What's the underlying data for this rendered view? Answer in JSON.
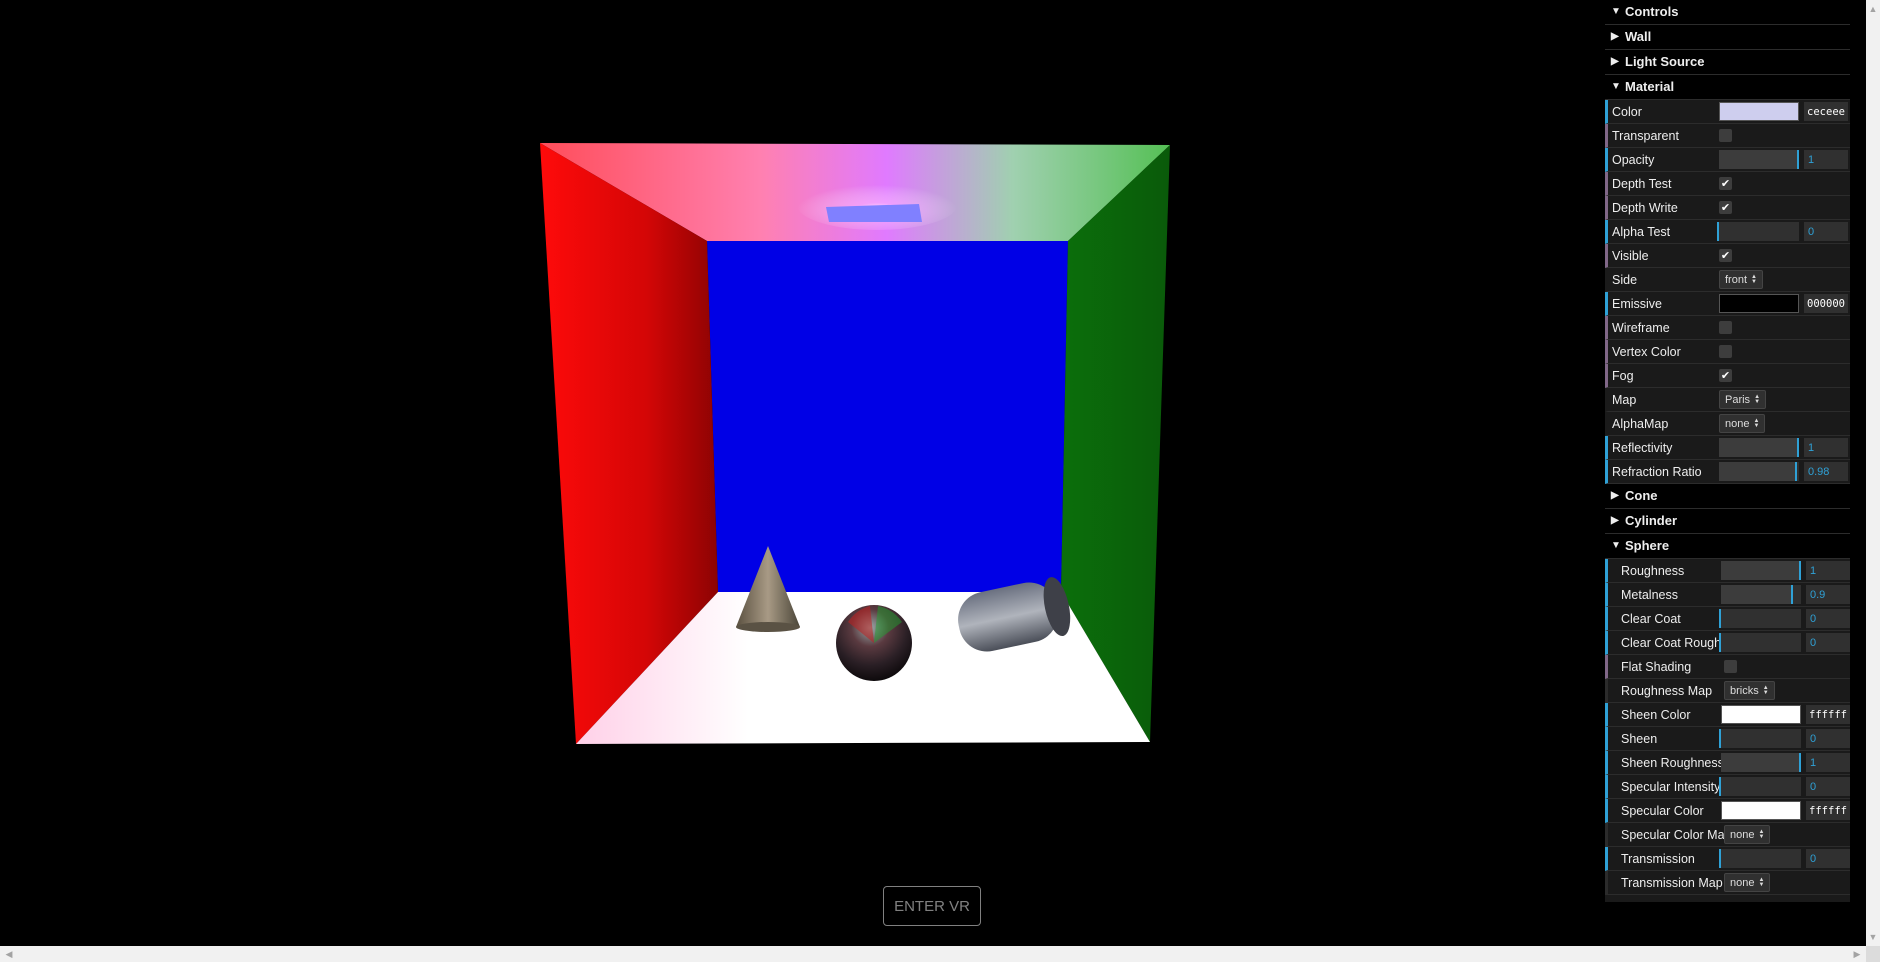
{
  "vr_button": "ENTER VR",
  "gui": {
    "title": "Controls",
    "folders_top": [
      {
        "label": "Wall",
        "open": false
      },
      {
        "label": "Light Source",
        "open": false
      }
    ],
    "material": {
      "label": "Material",
      "rows": [
        {
          "label": "Color",
          "type": "color",
          "color": "#ceceee",
          "hex": "ceceee"
        },
        {
          "label": "Transparent",
          "type": "bool",
          "checked": false
        },
        {
          "label": "Opacity",
          "type": "num",
          "value": "1",
          "fraction": 1
        },
        {
          "label": "Depth Test",
          "type": "bool",
          "checked": true
        },
        {
          "label": "Depth Write",
          "type": "bool",
          "checked": true
        },
        {
          "label": "Alpha Test",
          "type": "num",
          "value": "0",
          "fraction": 0
        },
        {
          "label": "Visible",
          "type": "bool",
          "checked": true
        },
        {
          "label": "Side",
          "type": "select",
          "value": "front"
        },
        {
          "label": "Emissive",
          "type": "color",
          "color": "#000000",
          "hex": "000000"
        },
        {
          "label": "Wireframe",
          "type": "bool",
          "checked": false
        },
        {
          "label": "Vertex Color",
          "type": "bool",
          "checked": false
        },
        {
          "label": "Fog",
          "type": "bool",
          "checked": true
        },
        {
          "label": "Map",
          "type": "select",
          "value": "Paris"
        },
        {
          "label": "AlphaMap",
          "type": "select",
          "value": "none"
        },
        {
          "label": "Reflectivity",
          "type": "num",
          "value": "1",
          "fraction": 1
        },
        {
          "label": "Refraction Ratio",
          "type": "num",
          "value": "0.98",
          "fraction": 0.98
        }
      ]
    },
    "folders_mid": [
      {
        "label": "Cone",
        "open": false
      },
      {
        "label": "Cylinder",
        "open": false
      }
    ],
    "sphere": {
      "label": "Sphere",
      "rows": [
        {
          "label": "Roughness",
          "type": "num",
          "value": "1",
          "fraction": 1
        },
        {
          "label": "Metalness",
          "type": "num",
          "value": "0.9",
          "fraction": 0.9
        },
        {
          "label": "Clear Coat",
          "type": "num",
          "value": "0",
          "fraction": 0
        },
        {
          "label": "Clear Coat Roughness",
          "type": "num",
          "value": "0",
          "fraction": 0
        },
        {
          "label": "Flat Shading",
          "type": "bool",
          "checked": false
        },
        {
          "label": "Roughness Map",
          "type": "select",
          "value": "bricks"
        },
        {
          "label": "Sheen Color",
          "type": "color",
          "color": "#ffffff",
          "hex": "ffffff"
        },
        {
          "label": "Sheen",
          "type": "num",
          "value": "0",
          "fraction": 0
        },
        {
          "label": "Sheen Roughness",
          "type": "num",
          "value": "1",
          "fraction": 1
        },
        {
          "label": "Specular Intensity",
          "type": "num",
          "value": "0",
          "fraction": 0
        },
        {
          "label": "Specular Color",
          "type": "color",
          "color": "#ffffff",
          "hex": "ffffff"
        },
        {
          "label": "Specular Color Map",
          "type": "select",
          "value": "none"
        },
        {
          "label": "Transmission",
          "type": "num",
          "value": "0",
          "fraction": 0
        },
        {
          "label": "Transmission Map",
          "type": "select",
          "value": "none"
        }
      ]
    }
  },
  "colors": {
    "left_wall": "#ff1010",
    "right_wall": "#0c8a0c",
    "back_wall": "#0000e0",
    "floor": "#ffffff",
    "slider_accent": "#2fa1d6"
  }
}
